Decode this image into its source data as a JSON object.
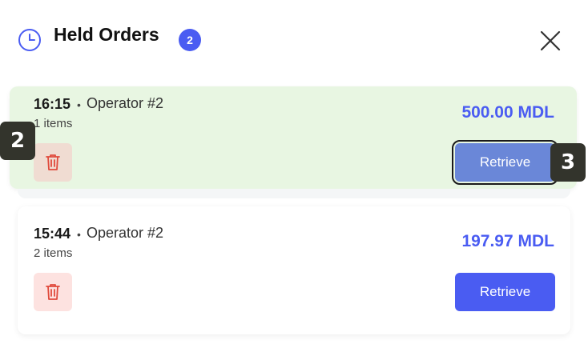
{
  "header": {
    "title": "Held Orders",
    "count": "2"
  },
  "orders": [
    {
      "time": "16:15",
      "separator": "•",
      "operator": "Operator #2",
      "items": "1 items",
      "amount": "500.00 MDL",
      "retrieve_label": "Retrieve",
      "highlighted": true
    },
    {
      "time": "15:44",
      "separator": "•",
      "operator": "Operator #2",
      "items": "2 items",
      "amount": "197.97 MDL",
      "retrieve_label": "Retrieve",
      "highlighted": false
    }
  ],
  "markers": [
    "2",
    "3"
  ],
  "colors": {
    "accent": "#4a5cf2",
    "highlight_card": "#e8f6e2",
    "delete_icon": "#e04a3c"
  }
}
